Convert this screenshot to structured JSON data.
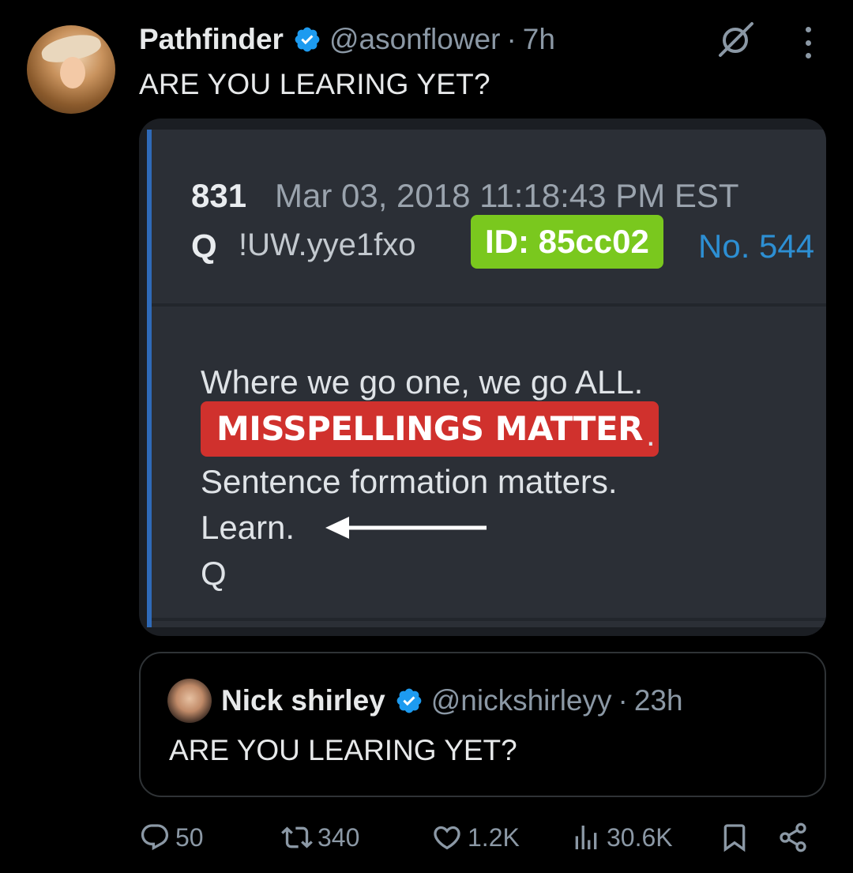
{
  "tweet": {
    "author_name": "Pathfinder",
    "handle": "@asonflower",
    "separator": "·",
    "time": "7h",
    "text": "ARE YOU LEARING YET?"
  },
  "media": {
    "post_number": "831",
    "post_date": "Mar 03, 2018 11:18:43 PM EST",
    "poster_name": "Q",
    "tripcode": "!UW.yye1fxo",
    "id_badge": "ID: 85cc02",
    "post_no": "No. 544",
    "lines": {
      "line1": "Where we go one, we go ALL.",
      "highlight": "MISSPELLINGS MATTER",
      "highlight_suffix": ".",
      "line3": "Sentence formation matters.",
      "line4": "Learn.",
      "line5": "Q"
    },
    "colors": {
      "id_badge": "#7ac81e",
      "highlight": "#d0312d",
      "post_no": "#2d8fd3"
    }
  },
  "quoted_tweet": {
    "author_name": "Nick shirley",
    "handle": "@nickshirleyy",
    "separator": "·",
    "time": "23h",
    "text": "ARE YOU LEARING YET?"
  },
  "actions": {
    "replies": "50",
    "reposts": "340",
    "likes": "1.2K",
    "views": "30.6K"
  },
  "icons": [
    "grok-icon",
    "more-icon",
    "verified-icon",
    "reply-icon",
    "repost-icon",
    "like-icon",
    "views-icon",
    "bookmark-icon",
    "share-icon"
  ]
}
